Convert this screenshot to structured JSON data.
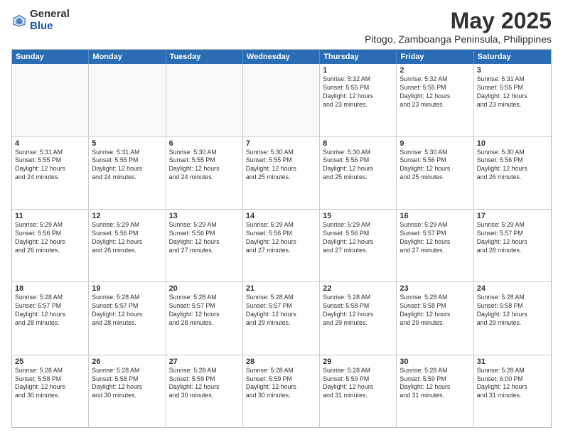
{
  "header": {
    "logo_general": "General",
    "logo_blue": "Blue",
    "main_title": "May 2025",
    "subtitle": "Pitogo, Zamboanga Peninsula, Philippines"
  },
  "calendar": {
    "days_of_week": [
      "Sunday",
      "Monday",
      "Tuesday",
      "Wednesday",
      "Thursday",
      "Friday",
      "Saturday"
    ],
    "weeks": [
      [
        {
          "day": "",
          "info": ""
        },
        {
          "day": "",
          "info": ""
        },
        {
          "day": "",
          "info": ""
        },
        {
          "day": "",
          "info": ""
        },
        {
          "day": "1",
          "info": "Sunrise: 5:32 AM\nSunset: 5:55 PM\nDaylight: 12 hours\nand 23 minutes."
        },
        {
          "day": "2",
          "info": "Sunrise: 5:32 AM\nSunset: 5:55 PM\nDaylight: 12 hours\nand 23 minutes."
        },
        {
          "day": "3",
          "info": "Sunrise: 5:31 AM\nSunset: 5:55 PM\nDaylight: 12 hours\nand 23 minutes."
        }
      ],
      [
        {
          "day": "4",
          "info": "Sunrise: 5:31 AM\nSunset: 5:55 PM\nDaylight: 12 hours\nand 24 minutes."
        },
        {
          "day": "5",
          "info": "Sunrise: 5:31 AM\nSunset: 5:55 PM\nDaylight: 12 hours\nand 24 minutes."
        },
        {
          "day": "6",
          "info": "Sunrise: 5:30 AM\nSunset: 5:55 PM\nDaylight: 12 hours\nand 24 minutes."
        },
        {
          "day": "7",
          "info": "Sunrise: 5:30 AM\nSunset: 5:55 PM\nDaylight: 12 hours\nand 25 minutes."
        },
        {
          "day": "8",
          "info": "Sunrise: 5:30 AM\nSunset: 5:56 PM\nDaylight: 12 hours\nand 25 minutes."
        },
        {
          "day": "9",
          "info": "Sunrise: 5:30 AM\nSunset: 5:56 PM\nDaylight: 12 hours\nand 25 minutes."
        },
        {
          "day": "10",
          "info": "Sunrise: 5:30 AM\nSunset: 5:56 PM\nDaylight: 12 hours\nand 26 minutes."
        }
      ],
      [
        {
          "day": "11",
          "info": "Sunrise: 5:29 AM\nSunset: 5:56 PM\nDaylight: 12 hours\nand 26 minutes."
        },
        {
          "day": "12",
          "info": "Sunrise: 5:29 AM\nSunset: 5:56 PM\nDaylight: 12 hours\nand 26 minutes."
        },
        {
          "day": "13",
          "info": "Sunrise: 5:29 AM\nSunset: 5:56 PM\nDaylight: 12 hours\nand 27 minutes."
        },
        {
          "day": "14",
          "info": "Sunrise: 5:29 AM\nSunset: 5:56 PM\nDaylight: 12 hours\nand 27 minutes."
        },
        {
          "day": "15",
          "info": "Sunrise: 5:29 AM\nSunset: 5:56 PM\nDaylight: 12 hours\nand 27 minutes."
        },
        {
          "day": "16",
          "info": "Sunrise: 5:29 AM\nSunset: 5:57 PM\nDaylight: 12 hours\nand 27 minutes."
        },
        {
          "day": "17",
          "info": "Sunrise: 5:29 AM\nSunset: 5:57 PM\nDaylight: 12 hours\nand 28 minutes."
        }
      ],
      [
        {
          "day": "18",
          "info": "Sunrise: 5:28 AM\nSunset: 5:57 PM\nDaylight: 12 hours\nand 28 minutes."
        },
        {
          "day": "19",
          "info": "Sunrise: 5:28 AM\nSunset: 5:57 PM\nDaylight: 12 hours\nand 28 minutes."
        },
        {
          "day": "20",
          "info": "Sunrise: 5:28 AM\nSunset: 5:57 PM\nDaylight: 12 hours\nand 28 minutes."
        },
        {
          "day": "21",
          "info": "Sunrise: 5:28 AM\nSunset: 5:57 PM\nDaylight: 12 hours\nand 29 minutes."
        },
        {
          "day": "22",
          "info": "Sunrise: 5:28 AM\nSunset: 5:58 PM\nDaylight: 12 hours\nand 29 minutes."
        },
        {
          "day": "23",
          "info": "Sunrise: 5:28 AM\nSunset: 5:58 PM\nDaylight: 12 hours\nand 29 minutes."
        },
        {
          "day": "24",
          "info": "Sunrise: 5:28 AM\nSunset: 5:58 PM\nDaylight: 12 hours\nand 29 minutes."
        }
      ],
      [
        {
          "day": "25",
          "info": "Sunrise: 5:28 AM\nSunset: 5:58 PM\nDaylight: 12 hours\nand 30 minutes."
        },
        {
          "day": "26",
          "info": "Sunrise: 5:28 AM\nSunset: 5:58 PM\nDaylight: 12 hours\nand 30 minutes."
        },
        {
          "day": "27",
          "info": "Sunrise: 5:28 AM\nSunset: 5:59 PM\nDaylight: 12 hours\nand 30 minutes."
        },
        {
          "day": "28",
          "info": "Sunrise: 5:28 AM\nSunset: 5:59 PM\nDaylight: 12 hours\nand 30 minutes."
        },
        {
          "day": "29",
          "info": "Sunrise: 5:28 AM\nSunset: 5:59 PM\nDaylight: 12 hours\nand 31 minutes."
        },
        {
          "day": "30",
          "info": "Sunrise: 5:28 AM\nSunset: 5:59 PM\nDaylight: 12 hours\nand 31 minutes."
        },
        {
          "day": "31",
          "info": "Sunrise: 5:28 AM\nSunset: 6:00 PM\nDaylight: 12 hours\nand 31 minutes."
        }
      ]
    ]
  }
}
